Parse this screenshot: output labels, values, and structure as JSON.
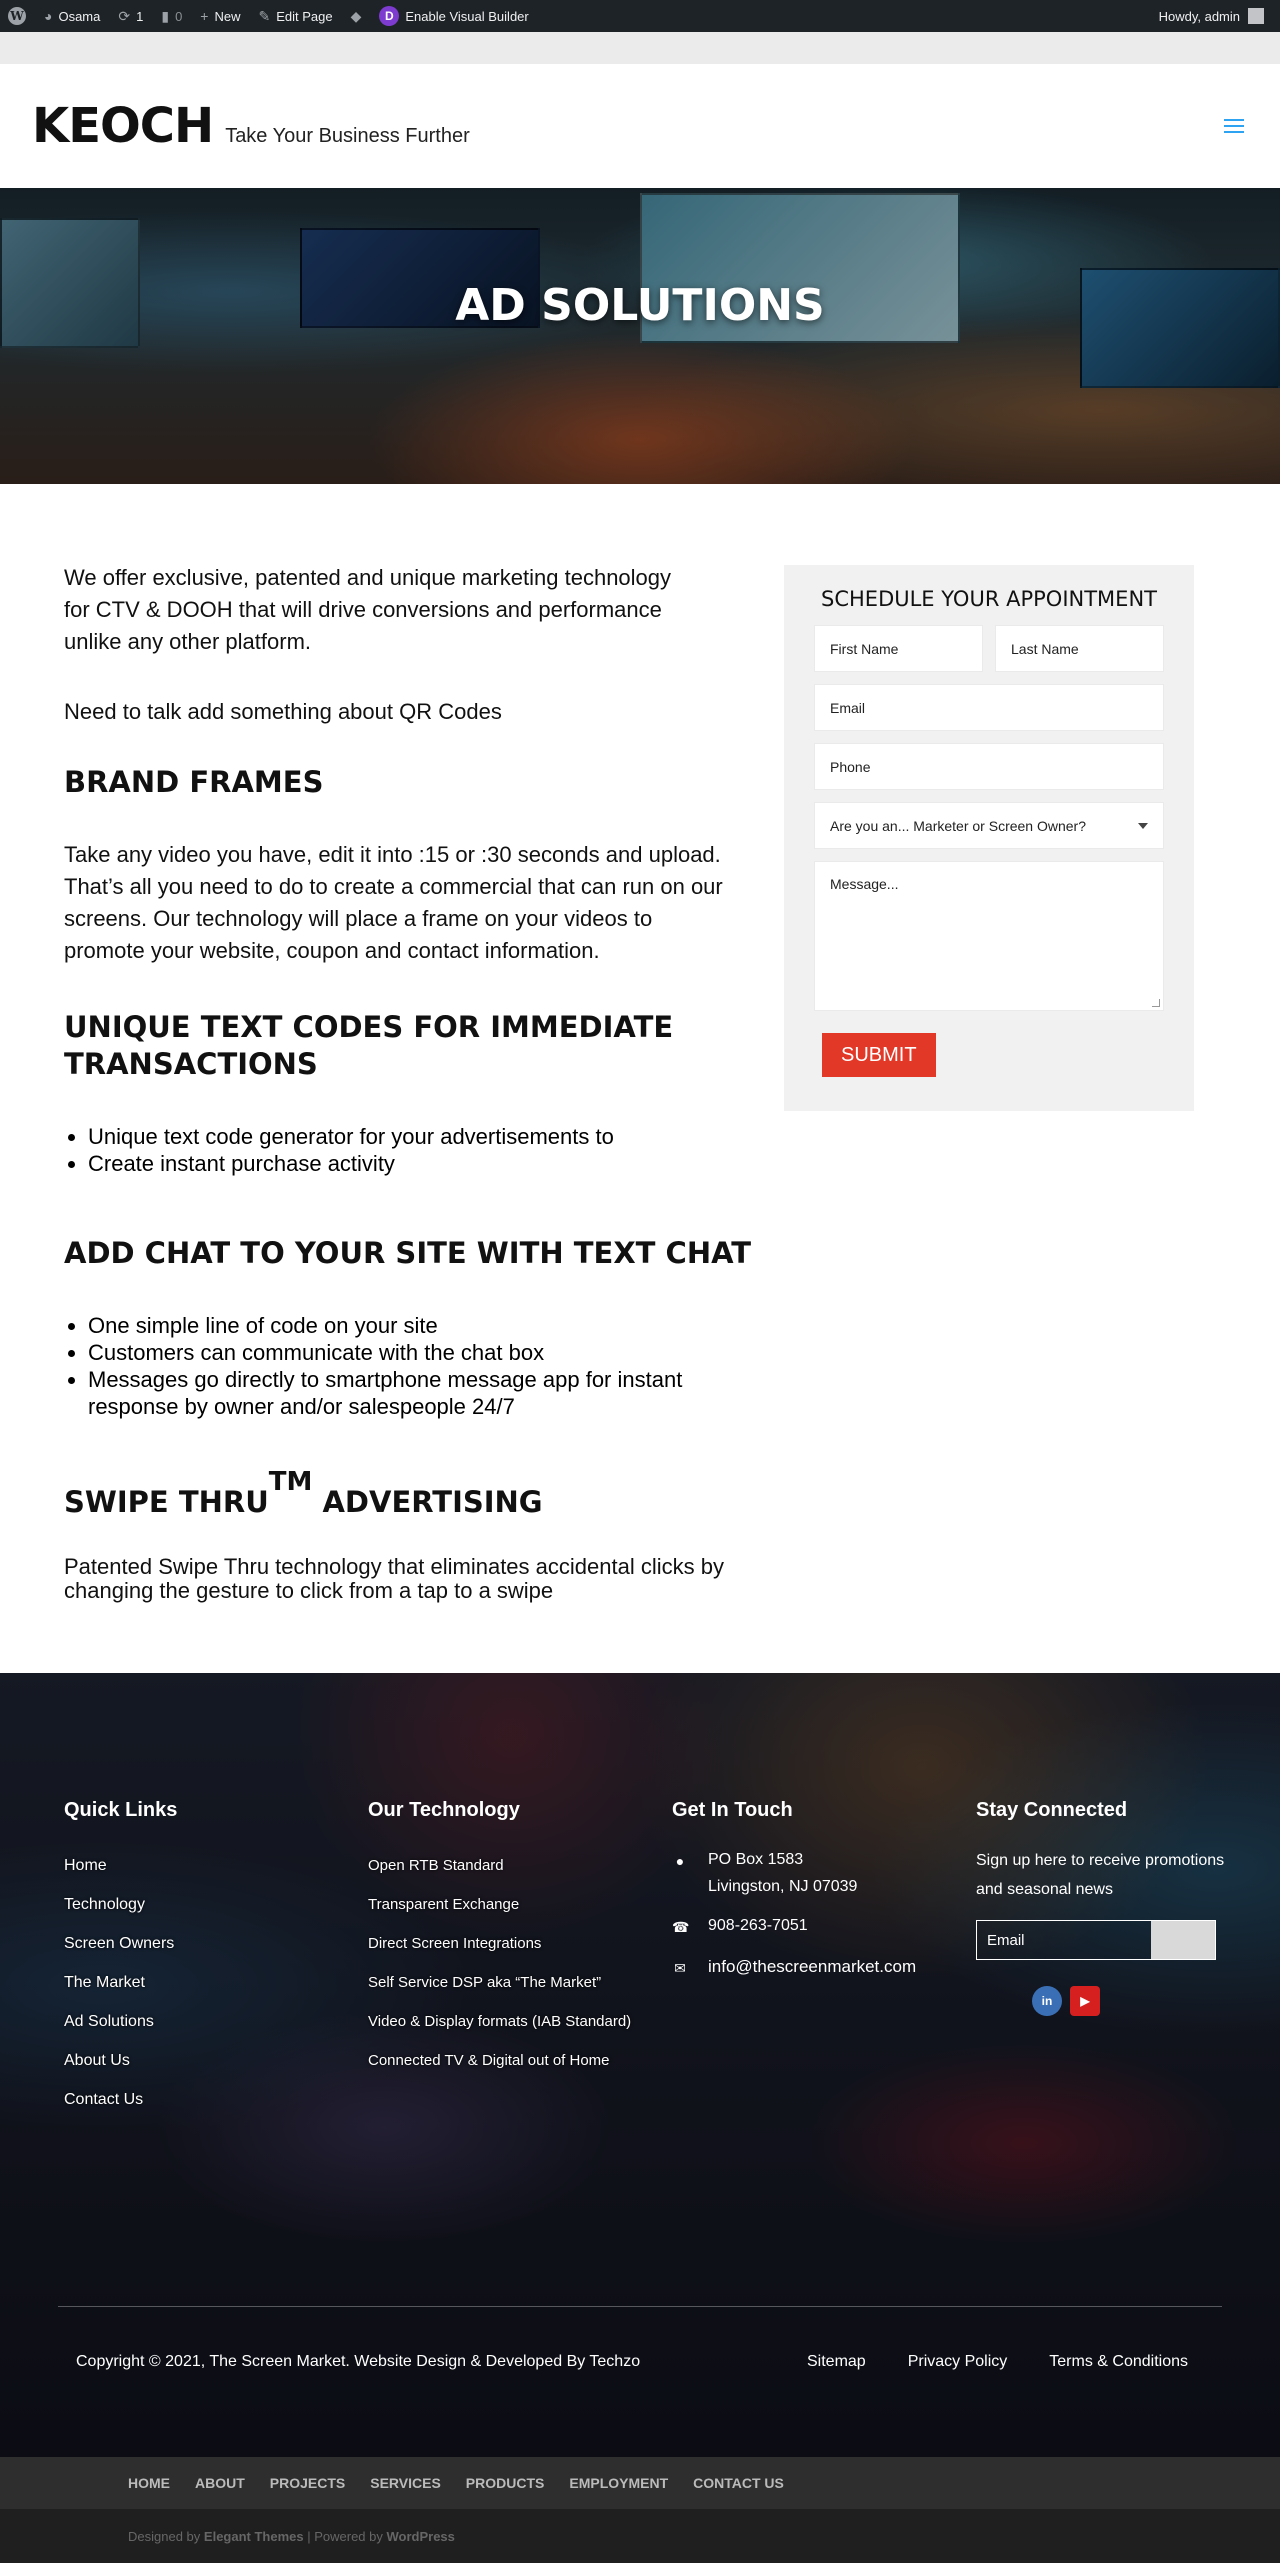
{
  "admin_bar": {
    "site_name": "Osama",
    "updates_count": "1",
    "comments_count": "0",
    "new_label": "New",
    "edit_label": "Edit Page",
    "builder_label": "Enable Visual Builder",
    "howdy": "Howdy, admin"
  },
  "header": {
    "logo": "KEOCH",
    "tagline": "Take Your Business Further"
  },
  "hero": {
    "title": "AD SOLUTIONS"
  },
  "main": {
    "intro": "We offer exclusive, patented and unique marketing technology for CTV & DOOH that will drive conversions and performance unlike any other platform.",
    "qr_note": "Need to talk add something about QR Codes",
    "brand_frames_title": "BRAND FRAMES",
    "brand_frames_text": "Take any video you have, edit it into :15 or :30 seconds and upload. That’s all you need to do to create a commercial that can run on our screens. Our technology will place a frame on your videos to promote your website, coupon and contact information.",
    "text_codes_title": "UNIQUE TEXT CODES FOR IMMEDIATE TRANSACTIONS",
    "text_codes_items": [
      "Unique text code generator for your advertisements to",
      "Create instant purchase activity"
    ],
    "chat_title": "ADD CHAT TO YOUR SITE WITH TEXT CHAT",
    "chat_items": [
      "One simple line of code on your site",
      "Customers can communicate with the chat box",
      "Messages go directly to smartphone message app for instant response by owner and/or salespeople 24/7"
    ],
    "swipe_title_a": "SWIPE THRU",
    "swipe_tm": "TM",
    "swipe_title_b": "ADVERTISING",
    "swipe_text": "Patented Swipe Thru technology that eliminates accidental clicks by changing the gesture to click from a tap to a swipe"
  },
  "form": {
    "title": "SCHEDULE YOUR APPOINTMENT",
    "first_name": "First Name",
    "last_name": "Last Name",
    "email": "Email",
    "phone": "Phone",
    "role_select": "Are you an... Marketer or Screen Owner?",
    "message": "Message...",
    "submit": "SUBMIT"
  },
  "footer": {
    "quick_links_title": "Quick Links",
    "quick_links": [
      "Home",
      "Technology",
      "Screen Owners",
      "The Market",
      "Ad Solutions",
      "About Us",
      "Contact Us"
    ],
    "tech_title": "Our Technology",
    "tech_links": [
      "Open RTB Standard",
      "Transparent Exchange",
      "Direct Screen Integrations",
      "Self Service DSP aka “The Market”",
      "Video & Display formats (IAB Standard)",
      "Connected TV & Digital out of Home"
    ],
    "contact_title": "Get In Touch",
    "address_line1": "PO Box 1583",
    "address_line2": "Livingston, NJ 07039",
    "phone": "908-263-7051",
    "email": "info@thescreenmarket.com",
    "stay_title": "Stay Connected",
    "stay_text": "Sign up here to receive promotions and seasonal news",
    "email_placeholder": "Email",
    "copyright": "Copyright © 2021, The Screen Market. Website Design & Developed By Techzo",
    "bottom_links": [
      "Sitemap",
      "Privacy Policy",
      "Terms & Conditions"
    ]
  },
  "bottom_nav": [
    "HOME",
    "ABOUT",
    "PROJECTS",
    "SERVICES",
    "PRODUCTS",
    "EMPLOYMENT",
    "CONTACT US"
  ],
  "credits": {
    "designed_by": "Designed by",
    "elegant": "Elegant Themes",
    "powered": "| Powered by",
    "wordpress": "WordPress"
  },
  "colors": {
    "admin_bar_bg": "#1d2327",
    "accent_blue": "#2ea3f2",
    "submit_red": "#e23828",
    "form_bg": "#f1f1f1",
    "bottom_nav_bg": "#2e2e2e",
    "credits_bg": "#1f1f1f"
  },
  "icons": [
    "wordpress-logo",
    "dashboard-icon",
    "updates-icon",
    "comments-icon",
    "plus-icon",
    "pencil-icon",
    "divi-icon",
    "map-pin-icon",
    "phone-icon",
    "envelope-icon",
    "linkedin-icon",
    "youtube-icon",
    "hamburger-icon"
  ]
}
